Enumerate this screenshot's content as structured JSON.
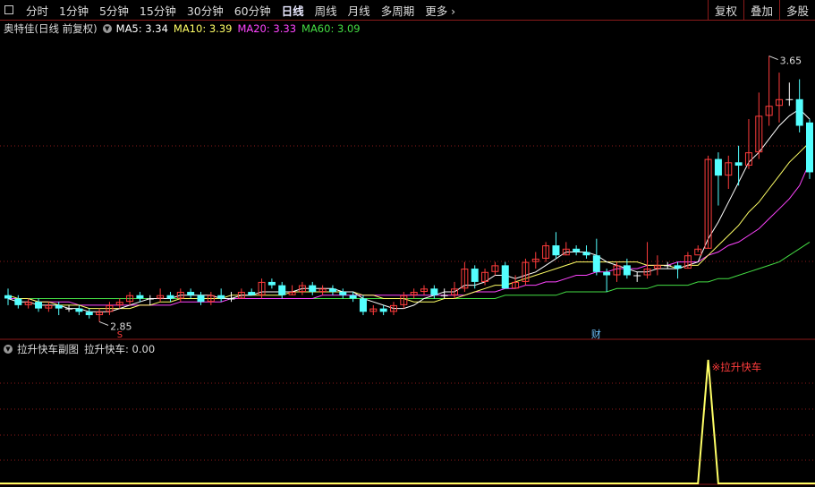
{
  "toolbar": {
    "periods": [
      "分时",
      "1分钟",
      "5分钟",
      "15分钟",
      "30分钟",
      "60分钟",
      "日线",
      "周线",
      "月线",
      "多周期",
      "更多"
    ],
    "active_period": "日线",
    "right_buttons": [
      "复权",
      "叠加",
      "多股"
    ]
  },
  "stock": {
    "name": "奥特佳",
    "mode": "(日线 前复权)"
  },
  "ma": {
    "ma5_label": "MA5: 3.34",
    "ma10_label": "MA10: 3.39",
    "ma20_label": "MA20: 3.33",
    "ma60_label": "MA60: 3.09"
  },
  "chart_annotations": {
    "high": "3.65",
    "low": "2.85",
    "fin_marker": "财",
    "s_marker": "S"
  },
  "sub": {
    "title": "拉升快车副图",
    "value_label": "拉升快车: 0.00",
    "signal_label": "※拉升快车"
  },
  "colors": {
    "up": "#ff3c3c",
    "down": "#54ffff",
    "ma5": "#ffffff",
    "ma10": "#ffff66",
    "ma20": "#ff44ff",
    "ma60": "#44dd44",
    "signal": "#ffff66",
    "grid": "#8b1a1a"
  },
  "chart_data": {
    "type": "candlestick",
    "price_range": [
      2.8,
      3.7
    ],
    "candles": [
      [
        2.93,
        2.92,
        2.95,
        2.9
      ],
      [
        2.92,
        2.9,
        2.93,
        2.89
      ],
      [
        2.9,
        2.91,
        2.92,
        2.89
      ],
      [
        2.91,
        2.89,
        2.92,
        2.88
      ],
      [
        2.89,
        2.9,
        2.91,
        2.88
      ],
      [
        2.9,
        2.89,
        2.91,
        2.87
      ],
      [
        2.89,
        2.89,
        2.9,
        2.88
      ],
      [
        2.89,
        2.88,
        2.9,
        2.87
      ],
      [
        2.88,
        2.87,
        2.89,
        2.86
      ],
      [
        2.87,
        2.88,
        2.89,
        2.85
      ],
      [
        2.88,
        2.9,
        2.91,
        2.87
      ],
      [
        2.9,
        2.91,
        2.92,
        2.89
      ],
      [
        2.91,
        2.93,
        2.94,
        2.9
      ],
      [
        2.93,
        2.92,
        2.94,
        2.91
      ],
      [
        2.92,
        2.92,
        2.93,
        2.9
      ],
      [
        2.92,
        2.93,
        2.95,
        2.91
      ],
      [
        2.93,
        2.92,
        2.94,
        2.91
      ],
      [
        2.92,
        2.94,
        2.95,
        2.91
      ],
      [
        2.94,
        2.93,
        2.95,
        2.92
      ],
      [
        2.93,
        2.91,
        2.94,
        2.9
      ],
      [
        2.91,
        2.93,
        2.94,
        2.9
      ],
      [
        2.93,
        2.92,
        2.95,
        2.91
      ],
      [
        2.92,
        2.92,
        2.94,
        2.91
      ],
      [
        2.92,
        2.94,
        2.95,
        2.92
      ],
      [
        2.94,
        2.93,
        2.95,
        2.93
      ],
      [
        2.93,
        2.97,
        2.98,
        2.92
      ],
      [
        2.97,
        2.96,
        2.98,
        2.95
      ],
      [
        2.96,
        2.93,
        2.97,
        2.92
      ],
      [
        2.93,
        2.94,
        2.96,
        2.93
      ],
      [
        2.94,
        2.96,
        2.97,
        2.93
      ],
      [
        2.96,
        2.94,
        2.97,
        2.93
      ],
      [
        2.94,
        2.95,
        2.96,
        2.93
      ],
      [
        2.95,
        2.94,
        2.96,
        2.93
      ],
      [
        2.94,
        2.93,
        2.95,
        2.92
      ],
      [
        2.93,
        2.92,
        2.94,
        2.91
      ],
      [
        2.92,
        2.88,
        2.93,
        2.87
      ],
      [
        2.88,
        2.89,
        2.9,
        2.87
      ],
      [
        2.89,
        2.88,
        2.9,
        2.87
      ],
      [
        2.88,
        2.9,
        2.91,
        2.87
      ],
      [
        2.9,
        2.93,
        2.94,
        2.89
      ],
      [
        2.93,
        2.94,
        2.95,
        2.92
      ],
      [
        2.94,
        2.95,
        2.96,
        2.93
      ],
      [
        2.95,
        2.93,
        2.96,
        2.92
      ],
      [
        2.93,
        2.93,
        2.95,
        2.92
      ],
      [
        2.93,
        2.95,
        2.97,
        2.92
      ],
      [
        2.95,
        3.01,
        3.03,
        2.94
      ],
      [
        3.01,
        2.97,
        3.02,
        2.95
      ],
      [
        2.97,
        3.0,
        3.01,
        2.96
      ],
      [
        3.0,
        3.02,
        3.03,
        2.99
      ],
      [
        3.02,
        2.95,
        3.03,
        2.95
      ],
      [
        2.95,
        2.97,
        2.99,
        2.95
      ],
      [
        2.97,
        3.03,
        3.04,
        2.96
      ],
      [
        3.03,
        3.04,
        3.06,
        3.01
      ],
      [
        3.04,
        3.08,
        3.09,
        3.03
      ],
      [
        3.08,
        3.05,
        3.12,
        3.04
      ],
      [
        3.05,
        3.07,
        3.09,
        3.05
      ],
      [
        3.07,
        3.06,
        3.08,
        3.05
      ],
      [
        3.06,
        3.05,
        3.08,
        3.04
      ],
      [
        3.05,
        3.0,
        3.1,
        2.99
      ],
      [
        3.0,
        2.99,
        3.01,
        2.94
      ],
      [
        2.99,
        3.02,
        3.03,
        2.97
      ],
      [
        3.02,
        2.99,
        3.04,
        2.98
      ],
      [
        2.99,
        2.99,
        3.0,
        2.97
      ],
      [
        2.99,
        3.01,
        3.09,
        2.98
      ],
      [
        3.01,
        3.02,
        3.05,
        2.99
      ],
      [
        3.02,
        3.02,
        3.03,
        3.01
      ],
      [
        3.02,
        3.01,
        3.03,
        2.98
      ],
      [
        3.01,
        3.05,
        3.06,
        3.01
      ],
      [
        3.05,
        3.07,
        3.08,
        3.06
      ],
      [
        3.07,
        3.34,
        3.35,
        3.07
      ],
      [
        3.34,
        3.29,
        3.36,
        3.2
      ],
      [
        3.29,
        3.33,
        3.35,
        3.25
      ],
      [
        3.33,
        3.32,
        3.38,
        3.26
      ],
      [
        3.32,
        3.36,
        3.46,
        3.31
      ],
      [
        3.36,
        3.47,
        3.54,
        3.34
      ],
      [
        3.47,
        3.5,
        3.65,
        3.44
      ],
      [
        3.5,
        3.52,
        3.6,
        3.45
      ],
      [
        3.52,
        3.52,
        3.57,
        3.5
      ],
      [
        3.52,
        3.44,
        3.58,
        3.42
      ],
      [
        3.45,
        3.3,
        3.46,
        3.28
      ]
    ],
    "ma5": [
      2.92,
      2.91,
      2.91,
      2.9,
      2.9,
      2.9,
      2.89,
      2.89,
      2.88,
      2.88,
      2.88,
      2.89,
      2.9,
      2.91,
      2.92,
      2.92,
      2.92,
      2.93,
      2.93,
      2.93,
      2.93,
      2.92,
      2.92,
      2.93,
      2.93,
      2.94,
      2.94,
      2.94,
      2.94,
      2.95,
      2.95,
      2.95,
      2.95,
      2.94,
      2.94,
      2.92,
      2.91,
      2.9,
      2.89,
      2.89,
      2.9,
      2.92,
      2.93,
      2.94,
      2.94,
      2.96,
      2.96,
      2.97,
      2.99,
      2.99,
      2.98,
      2.99,
      3.0,
      3.02,
      3.04,
      3.06,
      3.06,
      3.06,
      3.05,
      3.03,
      3.02,
      3.01,
      3.0,
      3.0,
      3.01,
      3.01,
      3.01,
      3.02,
      3.03,
      3.1,
      3.15,
      3.21,
      3.27,
      3.33,
      3.36,
      3.4,
      3.44,
      3.47,
      3.49,
      3.46
    ],
    "ma10": [
      2.93,
      2.92,
      2.92,
      2.91,
      2.91,
      2.9,
      2.9,
      2.9,
      2.89,
      2.89,
      2.89,
      2.89,
      2.89,
      2.9,
      2.9,
      2.91,
      2.91,
      2.92,
      2.92,
      2.92,
      2.92,
      2.92,
      2.93,
      2.93,
      2.93,
      2.93,
      2.93,
      2.93,
      2.94,
      2.94,
      2.94,
      2.94,
      2.94,
      2.94,
      2.94,
      2.93,
      2.93,
      2.92,
      2.92,
      2.92,
      2.91,
      2.91,
      2.91,
      2.92,
      2.92,
      2.93,
      2.94,
      2.95,
      2.96,
      2.96,
      2.97,
      2.98,
      2.99,
      3.0,
      3.01,
      3.02,
      3.03,
      3.03,
      3.03,
      3.03,
      3.03,
      3.03,
      3.03,
      3.02,
      3.02,
      3.02,
      3.01,
      3.02,
      3.02,
      3.05,
      3.08,
      3.11,
      3.14,
      3.18,
      3.21,
      3.25,
      3.29,
      3.33,
      3.36,
      3.39
    ],
    "ma20": [
      2.92,
      2.92,
      2.92,
      2.91,
      2.91,
      2.91,
      2.91,
      2.9,
      2.9,
      2.9,
      2.9,
      2.9,
      2.9,
      2.9,
      2.9,
      2.9,
      2.9,
      2.91,
      2.91,
      2.91,
      2.91,
      2.91,
      2.92,
      2.92,
      2.92,
      2.92,
      2.92,
      2.92,
      2.92,
      2.92,
      2.92,
      2.93,
      2.93,
      2.93,
      2.93,
      2.93,
      2.93,
      2.93,
      2.93,
      2.93,
      2.93,
      2.93,
      2.93,
      2.93,
      2.93,
      2.93,
      2.94,
      2.94,
      2.94,
      2.95,
      2.95,
      2.96,
      2.96,
      2.97,
      2.97,
      2.98,
      2.99,
      2.99,
      3.0,
      3.0,
      3.01,
      3.01,
      3.01,
      3.02,
      3.02,
      3.02,
      3.03,
      3.03,
      3.03,
      3.05,
      3.06,
      3.08,
      3.09,
      3.11,
      3.13,
      3.16,
      3.19,
      3.22,
      3.26,
      3.33
    ],
    "ma60": [
      2.92,
      2.92,
      2.92,
      2.92,
      2.92,
      2.92,
      2.92,
      2.92,
      2.92,
      2.92,
      2.92,
      2.92,
      2.92,
      2.92,
      2.92,
      2.92,
      2.92,
      2.92,
      2.92,
      2.92,
      2.92,
      2.92,
      2.92,
      2.92,
      2.92,
      2.92,
      2.92,
      2.92,
      2.92,
      2.92,
      2.92,
      2.92,
      2.92,
      2.92,
      2.92,
      2.92,
      2.92,
      2.92,
      2.92,
      2.92,
      2.92,
      2.92,
      2.92,
      2.92,
      2.92,
      2.92,
      2.92,
      2.92,
      2.92,
      2.93,
      2.93,
      2.93,
      2.93,
      2.93,
      2.93,
      2.94,
      2.94,
      2.94,
      2.94,
      2.94,
      2.95,
      2.95,
      2.95,
      2.95,
      2.96,
      2.96,
      2.96,
      2.96,
      2.97,
      2.97,
      2.98,
      2.98,
      2.99,
      3.0,
      3.01,
      3.02,
      3.03,
      3.05,
      3.07,
      3.09
    ],
    "signal": [
      0,
      0,
      0,
      0,
      0,
      0,
      0,
      0,
      0,
      0,
      0,
      0,
      0,
      0,
      0,
      0,
      0,
      0,
      0,
      0,
      0,
      0,
      0,
      0,
      0,
      0,
      0,
      0,
      0,
      0,
      0,
      0,
      0,
      0,
      0,
      0,
      0,
      0,
      0,
      0,
      0,
      0,
      0,
      0,
      0,
      0,
      0,
      0,
      0,
      0,
      0,
      0,
      0,
      0,
      0,
      0,
      0,
      0,
      0,
      0,
      0,
      0,
      0,
      0,
      0,
      0,
      0,
      0,
      0,
      1,
      0,
      0,
      0,
      0,
      0,
      0,
      0,
      0,
      0,
      0
    ]
  }
}
